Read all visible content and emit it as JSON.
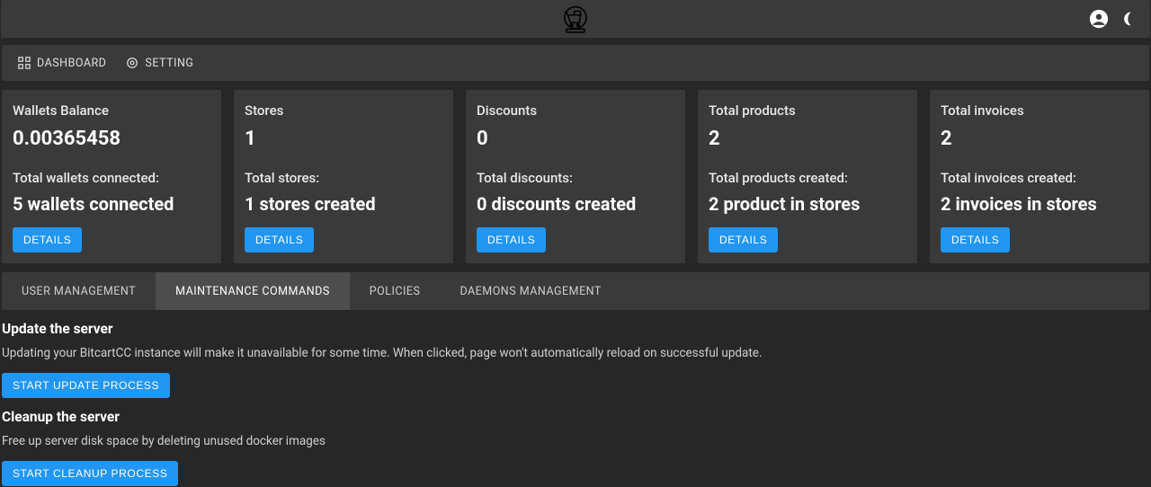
{
  "nav": {
    "dashboard": "DASHBOARD",
    "setting": "SETTING"
  },
  "cards": [
    {
      "title": "Wallets Balance",
      "value": "0.00365458",
      "sublabel": "Total wallets connected:",
      "subvalue": "5 wallets connected",
      "details": "DETAILS"
    },
    {
      "title": "Stores",
      "value": "1",
      "sublabel": "Total stores:",
      "subvalue": "1 stores created",
      "details": "DETAILS"
    },
    {
      "title": "Discounts",
      "value": "0",
      "sublabel": "Total discounts:",
      "subvalue": "0 discounts created",
      "details": "DETAILS"
    },
    {
      "title": "Total products",
      "value": "2",
      "sublabel": "Total products created:",
      "subvalue": "2 product in stores",
      "details": "DETAILS"
    },
    {
      "title": "Total invoices",
      "value": "2",
      "sublabel": "Total invoices created:",
      "subvalue": "2 invoices in stores",
      "details": "DETAILS"
    }
  ],
  "tabs": [
    {
      "label": "USER MANAGEMENT"
    },
    {
      "label": "MAINTENANCE COMMANDS"
    },
    {
      "label": "POLICIES"
    },
    {
      "label": "DAEMONS MANAGEMENT"
    }
  ],
  "activeTab": 1,
  "sections": {
    "update": {
      "title": "Update the server",
      "desc": "Updating your BitcartCC instance will make it unavailable for some time. When clicked, page won't automatically reload on successful update.",
      "button": "START UPDATE PROCESS"
    },
    "cleanup": {
      "title": "Cleanup the server",
      "desc": "Free up server disk space by deleting unused docker images",
      "button": "START CLEANUP PROCESS"
    }
  }
}
